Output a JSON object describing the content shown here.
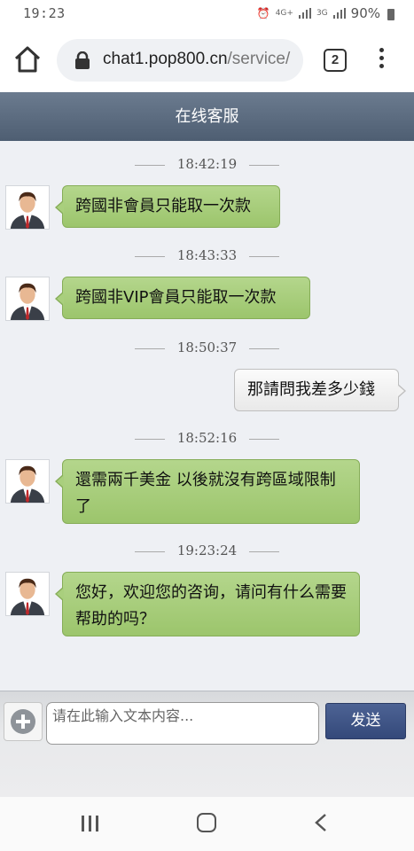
{
  "status_bar": {
    "time": "19:23",
    "network_1": "4G+",
    "network_2": "3G",
    "battery": "90%"
  },
  "browser": {
    "url_domain": "chat1.pop800.cn",
    "url_path": "/service/",
    "tab_count": "2"
  },
  "chat": {
    "title": "在线客服",
    "messages": [
      {
        "time": "18:42:19",
        "sender": "agent",
        "text": "跨國非會員只能取一次款"
      },
      {
        "time": "18:43:33",
        "sender": "agent",
        "text": "跨國非VIP會員只能取一次款"
      },
      {
        "time": "18:50:37",
        "sender": "user",
        "text": "那請問我差多少錢"
      },
      {
        "time": "18:52:16",
        "sender": "agent",
        "text": "還需兩千美金 以後就沒有跨區域限制了"
      },
      {
        "time": "19:23:24",
        "sender": "agent",
        "text": "您好，欢迎您的咨询，请问有什么需要帮助的吗？"
      }
    ]
  },
  "input": {
    "placeholder": "请在此输入文本内容...",
    "value": "",
    "send_label": "发送"
  },
  "colors": {
    "header": "#5a6a7e",
    "agent_bubble": "#a9cf7d",
    "user_bubble": "#f2f2f2",
    "send_button": "#3f5486"
  }
}
